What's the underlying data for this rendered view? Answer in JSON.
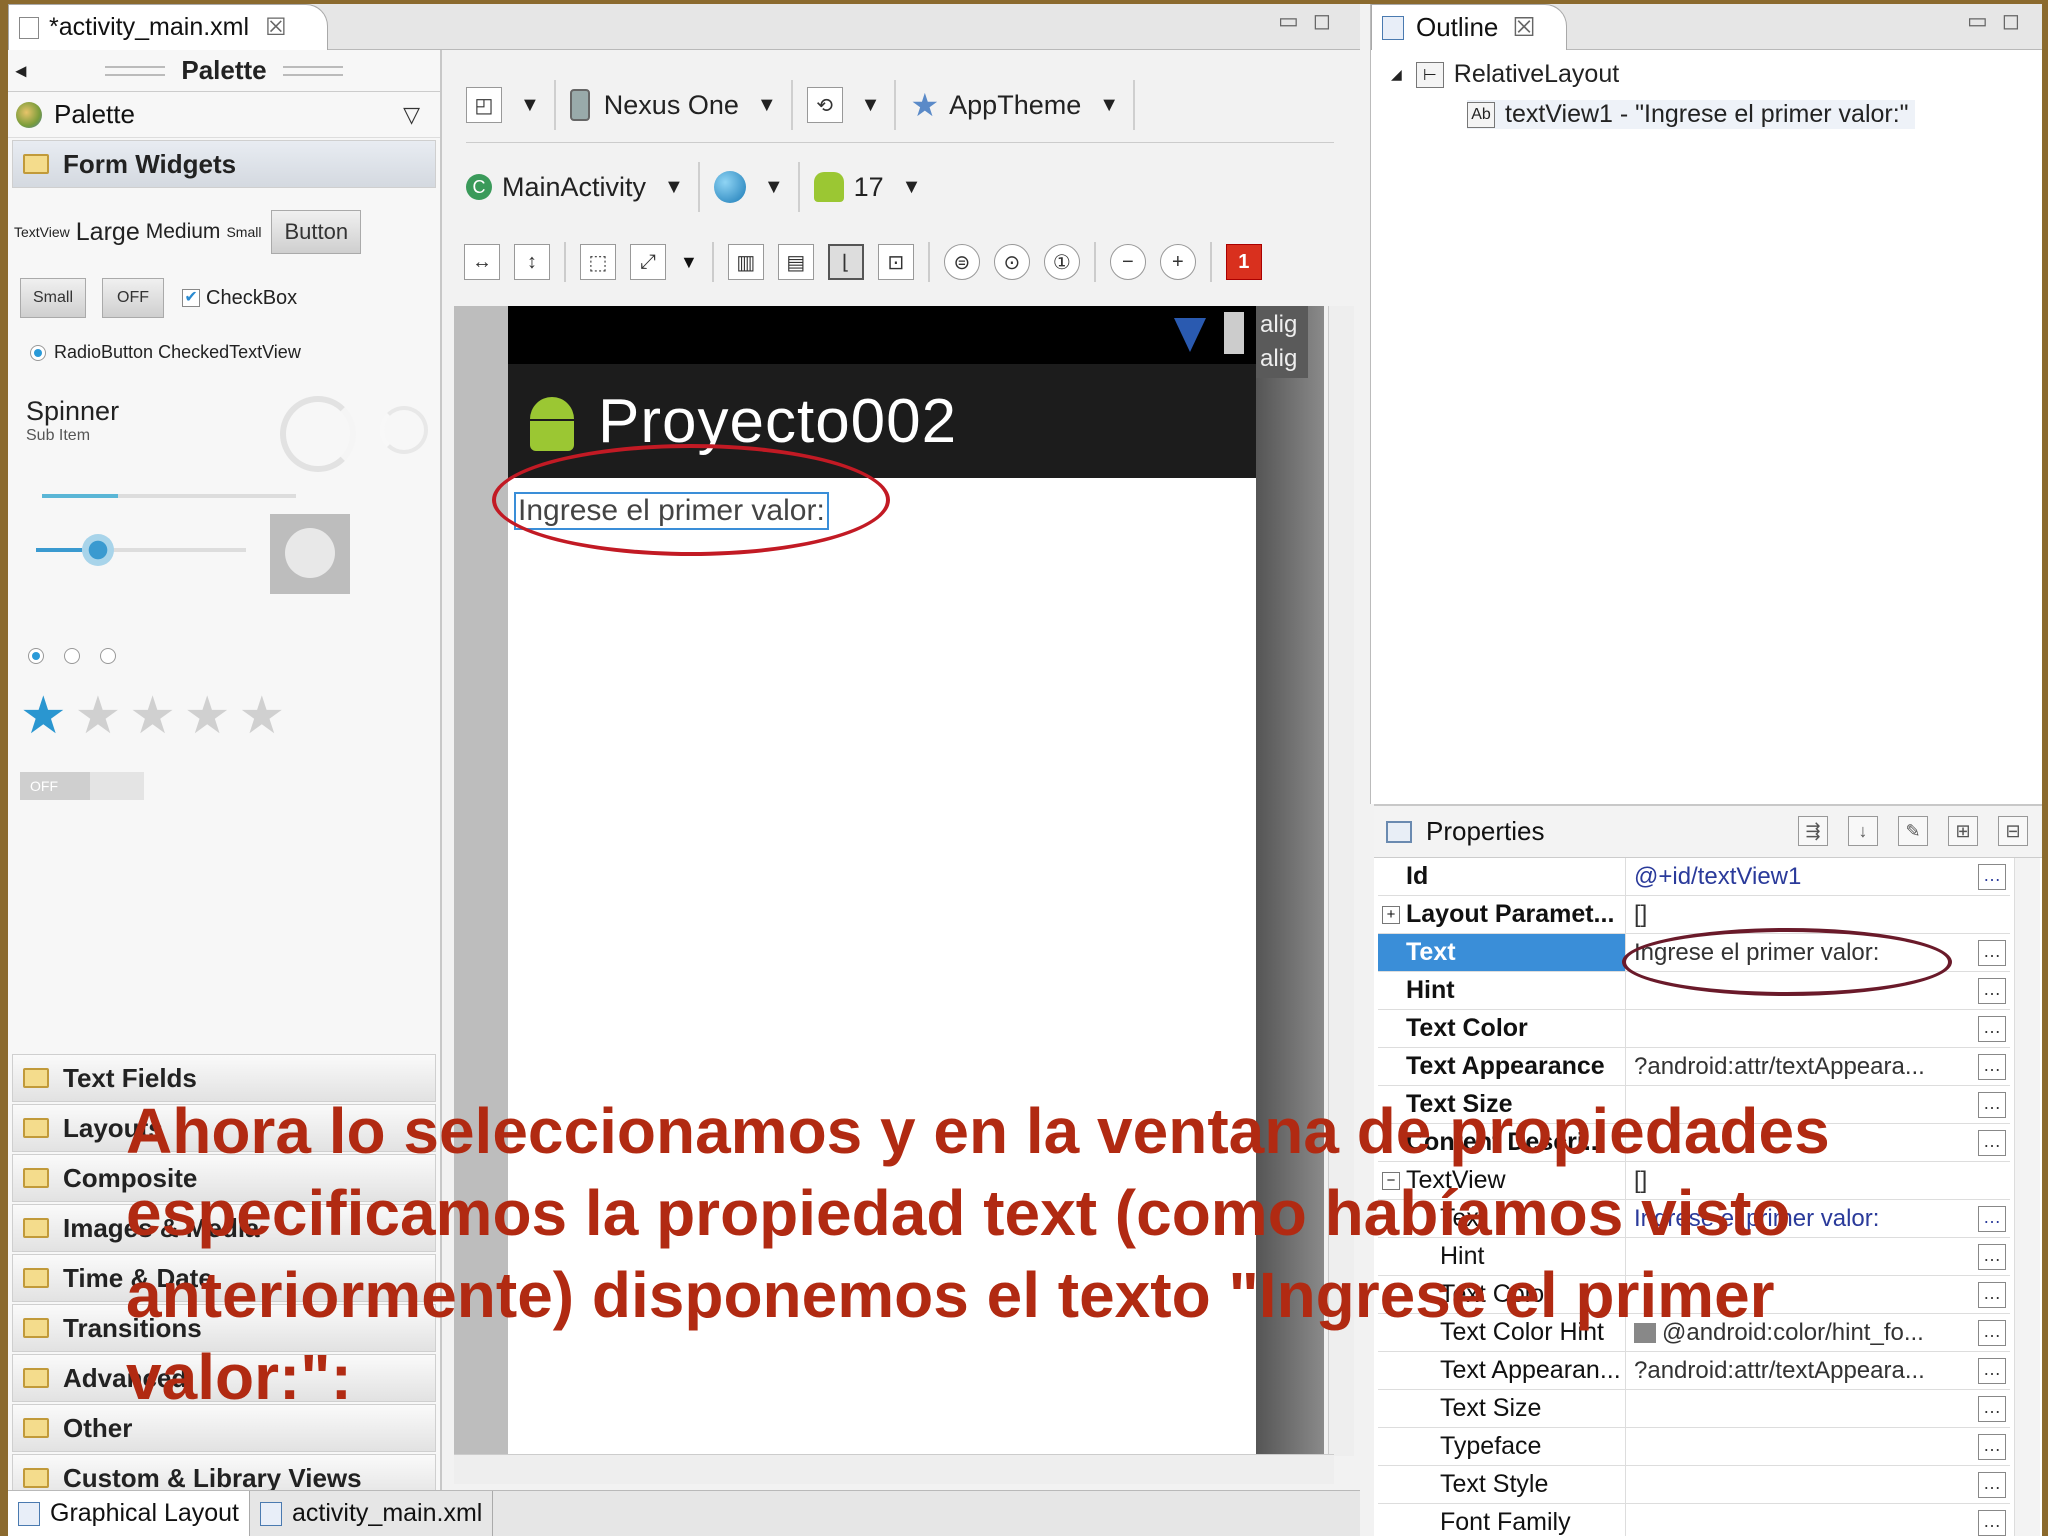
{
  "editor_tab": {
    "label": "*activity_main.xml",
    "close": "☒"
  },
  "palette": {
    "title": "Palette",
    "dropdown": "Palette",
    "form_widgets": "Form Widgets",
    "textview_sizes": [
      "TextView",
      "Large",
      "Medium",
      "Small"
    ],
    "button": "Button",
    "small_btn": "Small",
    "off_toggle": "OFF",
    "checkbox": "CheckBox",
    "radio_row": "RadioButton CheckedTextView",
    "spinner": "Spinner",
    "spinner_sub": "Sub Item",
    "switch_off": "OFF",
    "categories": [
      "Text Fields",
      "Layouts",
      "Composite",
      "Images & Media",
      "Time & Date",
      "Transitions",
      "Advanced",
      "Other",
      "Custom & Library Views"
    ]
  },
  "toolbar": {
    "device": "Nexus One",
    "theme": "AppTheme",
    "activity": "MainActivity",
    "api": "17",
    "error_count": "1"
  },
  "device": {
    "app_title": "Proyecto002",
    "textview": "Ingrese el primer valor:",
    "align_labels": [
      "alig",
      "alig"
    ]
  },
  "outline": {
    "title": "Outline",
    "root": "RelativeLayout",
    "child": "textView1 - \"Ingrese el primer valor:\""
  },
  "properties": {
    "title": "Properties",
    "rows": [
      {
        "name": "Id",
        "value": "@+id/textView1"
      },
      {
        "name": "Layout Paramet...",
        "value": "[]"
      },
      {
        "name": "Text",
        "value": "Ingrese el primer valor:"
      },
      {
        "name": "Hint",
        "value": ""
      },
      {
        "name": "Text Color",
        "value": ""
      },
      {
        "name": "Text Appearance",
        "value": "?android:attr/textAppeara..."
      },
      {
        "name": "Text Size",
        "value": ""
      },
      {
        "name": "Content Descri...",
        "value": ""
      },
      {
        "name": "TextView",
        "value": "[]"
      },
      {
        "name": "Text",
        "value": "Ingrese el primer valor:"
      },
      {
        "name": "Hint",
        "value": ""
      },
      {
        "name": "Text Color",
        "value": ""
      },
      {
        "name": "Text Color Hint",
        "value": "@android:color/hint_fo..."
      },
      {
        "name": "Text Appearan...",
        "value": "?android:attr/textAppeara..."
      },
      {
        "name": "Text Size",
        "value": ""
      },
      {
        "name": "Typeface",
        "value": ""
      },
      {
        "name": "Text Style",
        "value": ""
      },
      {
        "name": "Font Family",
        "value": ""
      }
    ]
  },
  "bottom_tabs": [
    "Graphical Layout",
    "activity_main.xml"
  ],
  "caption": "Ahora lo seleccionamos y en la ventana de propiedades especificamos la propiedad text (como habíamos visto anteriormente) disponemos el texto \"Ingrese el primer valor:\":",
  "colors": {
    "highlight": "#3a8ed8",
    "caption": "#b12a12",
    "ellipse": "#c21a24"
  }
}
